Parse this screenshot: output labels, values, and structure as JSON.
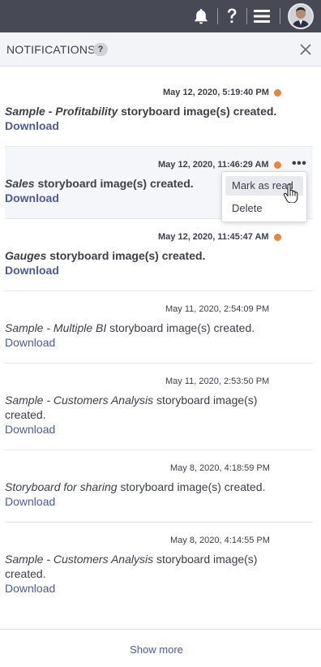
{
  "header": {
    "title": "NOTIFICATIONS",
    "help": "?"
  },
  "colors": {
    "topbar": "#474a55",
    "unread_dot": "#e8863a",
    "link": "#4a5aa8"
  },
  "notifications": [
    {
      "timestamp": "May 12, 2020, 5:19:40 PM",
      "name": "Sample - Profitability",
      "text": " storyboard image(s) created.",
      "link": "Download",
      "unread": true
    },
    {
      "timestamp": "May 12, 2020, 11:46:29 AM",
      "name": "Sales",
      "text": " storyboard image(s) created.",
      "link": "Download",
      "unread": true,
      "more": "•••"
    },
    {
      "timestamp": "May 12, 2020, 11:45:47 AM",
      "name": "Gauges",
      "text": " storyboard image(s) created.",
      "link": "Download",
      "unread": true
    },
    {
      "timestamp": "May 11, 2020, 2:54:09 PM",
      "name": "Sample - Multiple BI",
      "text": " storyboard image(s) created.",
      "link": "Download",
      "unread": false
    },
    {
      "timestamp": "May 11, 2020, 2:53:50 PM",
      "name": "Sample - Customers Analysis",
      "text": " storyboard image(s) created.",
      "link": "Download",
      "unread": false
    },
    {
      "timestamp": "May 8, 2020, 4:18:59 PM",
      "name": "Storyboard for sharing",
      "text": " storyboard image(s) created.",
      "link": "Download",
      "unread": false
    },
    {
      "timestamp": "May 8, 2020, 4:14:55 PM",
      "name": "Sample - Customers Analysis",
      "text": " storyboard image(s) created.",
      "link": "Download",
      "unread": false
    }
  ],
  "context_menu": {
    "mark_as_read": "Mark as read",
    "delete": "Delete"
  },
  "footer": {
    "show_more": "Show more"
  }
}
